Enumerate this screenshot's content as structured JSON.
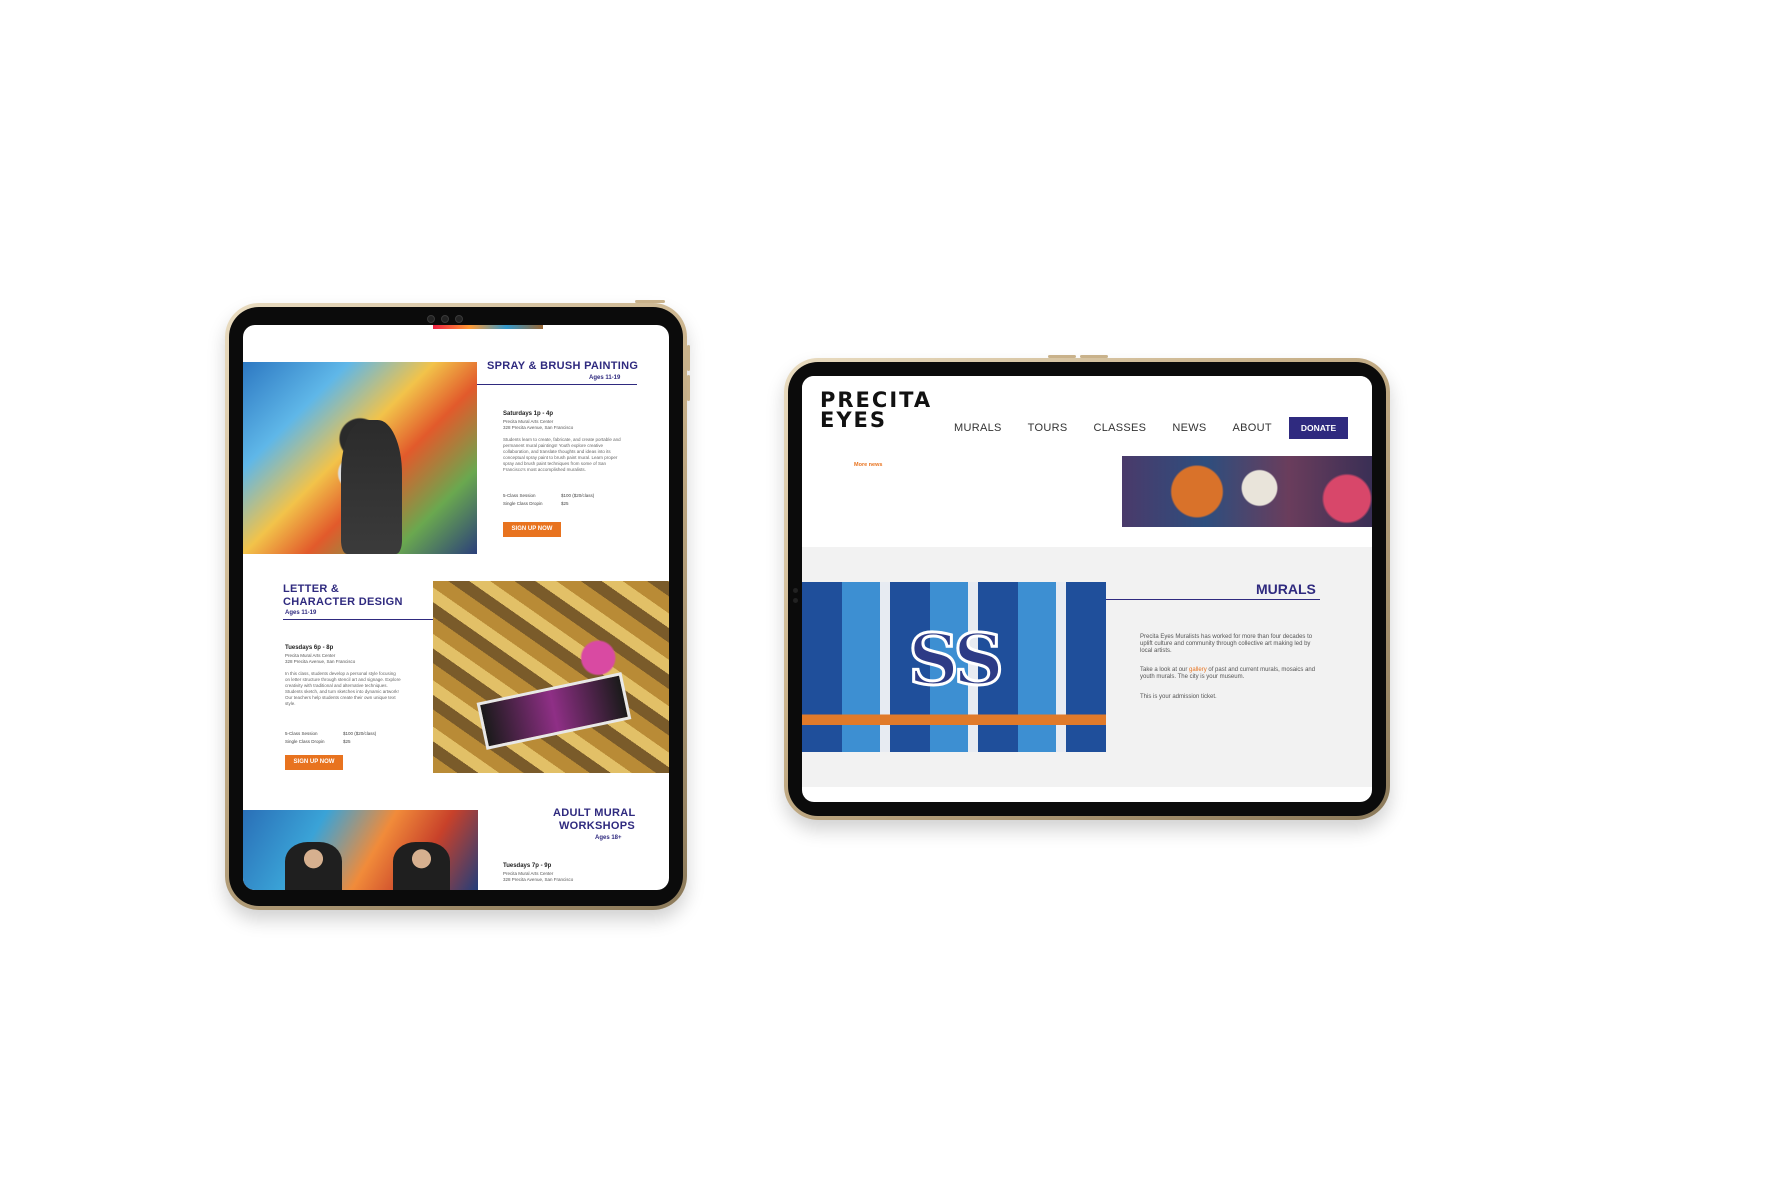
{
  "portrait": {
    "spray": {
      "title": "SPRAY & BRUSH PAINTING",
      "ages": "Ages 11-19",
      "schedule": "Saturdays 1p - 4p",
      "location": "Precita Mural Arts Center",
      "address": "328 Precita Avenue, San Francisco",
      "description": "Students learn to create, fabricate, and create portable and permanent mural paintings! Youth explore creative collaboration, and translate thoughts and ideas into its conceptual spray paint to brush paint mural. Learn proper spray and brush paint techniques from some of San Francisco's most accomplished muralists.",
      "price_series_label": "5-Class Session",
      "price_series_value": "$100 ($20/class)",
      "price_single_label": "Single Class Dropin",
      "price_single_value": "$25",
      "button": "SIGN UP NOW"
    },
    "letter": {
      "title_line1": "LETTER &",
      "title_line2": "CHARACTER DESIGN",
      "ages": "Ages 11-19",
      "schedule": "Tuesdays 6p - 8p",
      "location": "Precita Mural Arts Center",
      "address": "328 Precita Avenue, San Francisco",
      "description": "In this class, students develop a personal style focusing on letter structure through stencil art and signage. Explore creativity with traditional and alternative techniques. Students sketch, and turn sketches into dynamic artwork! Our teachers help students create their own unique text style.",
      "price_series_label": "5-Class Session",
      "price_series_value": "$100 ($20/class)",
      "price_single_label": "Single Class Dropin",
      "price_single_value": "$25",
      "button": "SIGN UP NOW"
    },
    "adult": {
      "title_line1": "ADULT MURAL",
      "title_line2": "WORKSHOPS",
      "ages": "Ages 18+",
      "schedule": "Tuesdays 7p - 9p",
      "location": "Precita Mural Arts Center",
      "address": "328 Precita Avenue, San Francisco"
    }
  },
  "landscape": {
    "logo_line1": "PRECITA",
    "logo_line2": "EYES",
    "nav": [
      "MURALS",
      "TOURS",
      "CLASSES",
      "NEWS",
      "ABOUT"
    ],
    "donate": "DONATE",
    "more_news": "More news",
    "murals_title": "MURALS",
    "para1": "Precita Eyes Muralists has worked for more than four decades to uplift culture and community through collective art making led by local artists.",
    "para2_before": "Take a look at our ",
    "para2_link": "gallery",
    "para2_after": " of past and current murals, mosaics and youth murals. The city is your museum.",
    "para3": "This is your admission ticket.",
    "mural_letters": "SS"
  },
  "colors": {
    "brand_purple": "#2f2a7f",
    "accent_orange": "#e8731f",
    "band_gray": "#f2f2f2",
    "device_gold": "#c9b28b"
  },
  "icons": [
    "camera-icon",
    "home-button-icon"
  ]
}
